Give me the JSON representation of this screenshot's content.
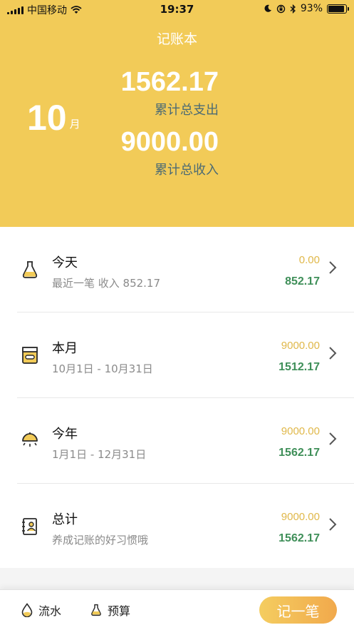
{
  "status_bar": {
    "carrier": "中国移动",
    "time": "19:37",
    "battery": "93%",
    "battery_level": 0.93,
    "icons": [
      "signal-icon",
      "wifi-icon",
      "moon-icon",
      "orientation-lock-icon",
      "bluetooth-icon",
      "battery-icon"
    ]
  },
  "header": {
    "title": "记账本",
    "month_number": "10",
    "month_unit": "月",
    "total_expense_value": "1562.17",
    "total_expense_label": "累计总支出",
    "total_income_value": "9000.00",
    "total_income_label": "累计总收入"
  },
  "rows": [
    {
      "icon": "flask-icon",
      "name": "今天",
      "subtitle": "最近一笔 收入 852.17",
      "amount_top": "0.00",
      "amount_bottom": "852.17"
    },
    {
      "icon": "calendar-icon",
      "name": "本月",
      "subtitle": "10月1日 - 10月31日",
      "amount_top": "9000.00",
      "amount_bottom": "1512.17"
    },
    {
      "icon": "sunrise-icon",
      "name": "今年",
      "subtitle": "1月1日 - 12月31日",
      "amount_top": "9000.00",
      "amount_bottom": "1562.17"
    },
    {
      "icon": "contacts-book-icon",
      "name": "总计",
      "subtitle": "养成记账的好习惯哦",
      "amount_top": "9000.00",
      "amount_bottom": "1562.17"
    }
  ],
  "tabbar": {
    "tab_flow": {
      "label": "流水",
      "icon": "drop-icon"
    },
    "tab_budget": {
      "label": "预算",
      "icon": "flask-icon"
    },
    "record_button": "记一笔"
  },
  "colors": {
    "header_bg": "#f2cb58",
    "label_text": "#4c6b74",
    "amount_income": "#e0b84a",
    "amount_expense": "#3f8f59",
    "accent": "#f1a94c"
  }
}
